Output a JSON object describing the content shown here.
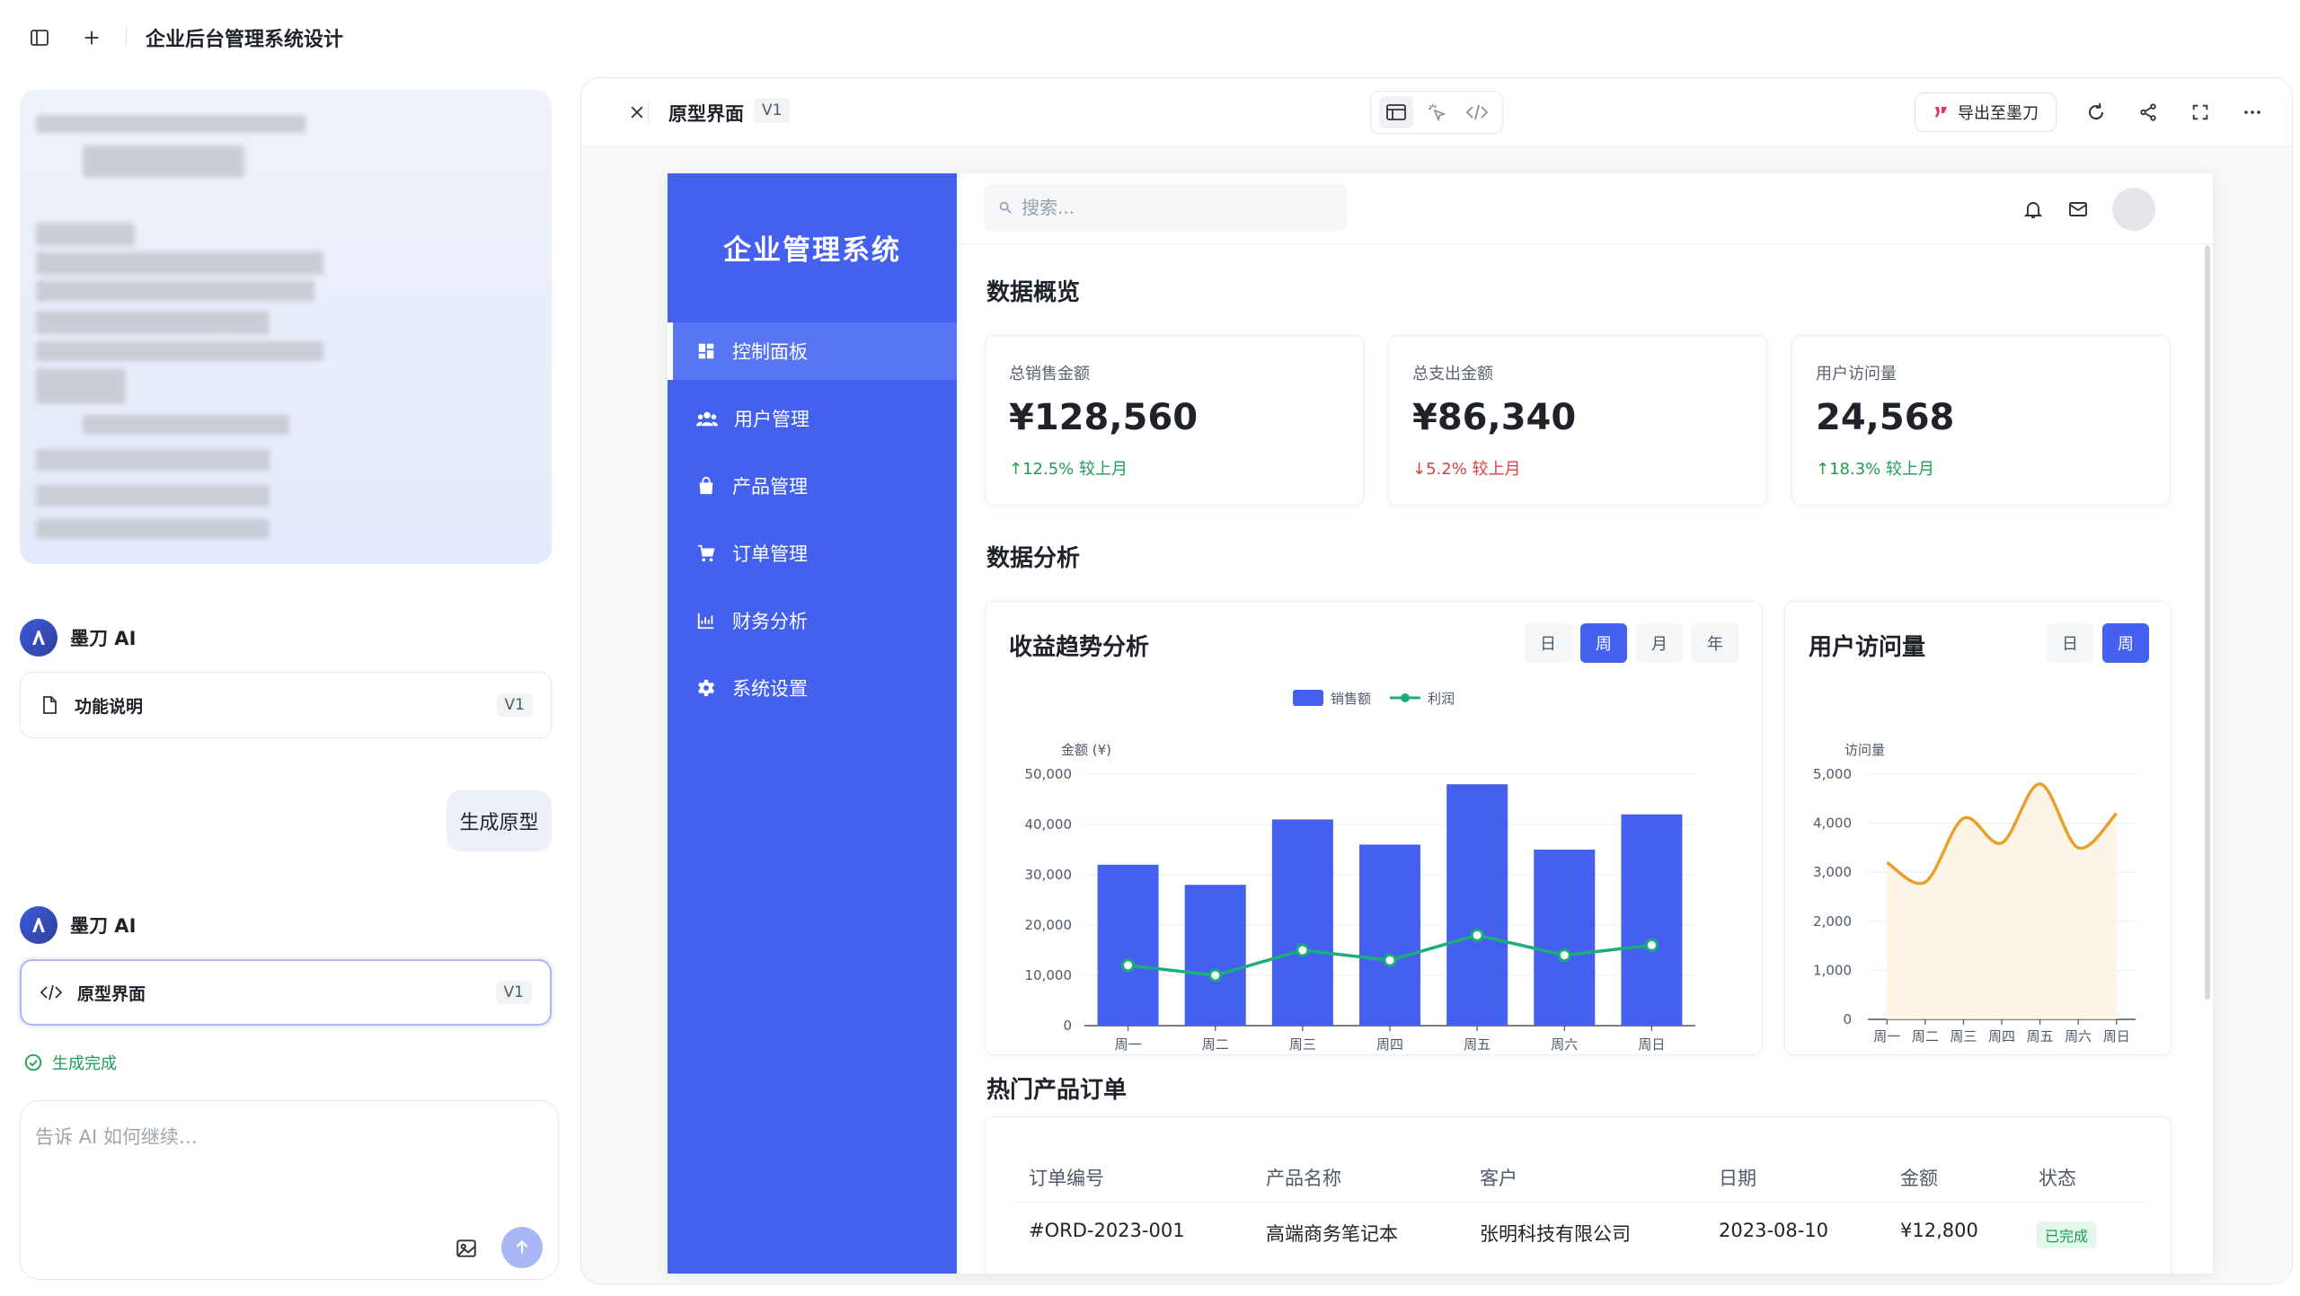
{
  "topbar": {
    "title": "企业后台管理系统设计"
  },
  "chat": {
    "messages": [
      {
        "sender": "墨刀 AI",
        "file": "功能说明",
        "version": "V1"
      },
      {
        "user_text": "生成原型"
      },
      {
        "sender": "墨刀 AI",
        "file": "原型界面",
        "version": "V1"
      }
    ],
    "status": "生成完成",
    "input_placeholder": "告诉 AI 如何继续…"
  },
  "preview_panel": {
    "title": "原型界面",
    "version": "V1",
    "export_label": "导出至墨刀"
  },
  "app": {
    "brand": "企业管理系统",
    "nav": [
      {
        "label": "控制面板",
        "icon": "dashboard-icon",
        "active": true
      },
      {
        "label": "用户管理",
        "icon": "users-icon",
        "active": false
      },
      {
        "label": "产品管理",
        "icon": "bag-icon",
        "active": false
      },
      {
        "label": "订单管理",
        "icon": "cart-icon",
        "active": false
      },
      {
        "label": "财务分析",
        "icon": "finance-icon",
        "active": false
      },
      {
        "label": "系统设置",
        "icon": "gear-icon",
        "active": false
      }
    ],
    "search_placeholder": "搜索...",
    "overview_title": "数据概览",
    "kpis": [
      {
        "label": "总销售金额",
        "value": "¥128,560",
        "change": "↑12.5% 较上月",
        "trend": "up"
      },
      {
        "label": "总支出金额",
        "value": "¥86,340",
        "change": "↓5.2% 较上月",
        "trend": "down"
      },
      {
        "label": "用户访问量",
        "value": "24,568",
        "change": "↑18.3% 较上月",
        "trend": "up"
      }
    ],
    "analysis_title": "数据分析",
    "revenue_card": {
      "title": "收益趋势分析",
      "ranges": [
        "日",
        "周",
        "月",
        "年"
      ],
      "selected": "周"
    },
    "visits_card": {
      "title": "用户访问量",
      "ranges": [
        "日",
        "周"
      ],
      "selected": "周"
    },
    "orders_title": "热门产品订单",
    "orders": {
      "headers": [
        "订单编号",
        "产品名称",
        "客户",
        "日期",
        "金额",
        "状态"
      ],
      "rows": [
        {
          "id": "#ORD-2023-001",
          "product": "高端商务笔记本",
          "customer": "张明科技有限公司",
          "date": "2023-08-10",
          "amount": "¥12,800",
          "status": "已完成"
        }
      ]
    }
  },
  "colors": {
    "primary": "#4361ee",
    "profit": "#1aae7a",
    "visits": "#e7a12a",
    "up": "#1f9d55",
    "down": "#e03e3e"
  },
  "chart_data": [
    {
      "type": "bar",
      "legend": [
        "销售额",
        "利润"
      ],
      "ylabel": "金额 (¥)",
      "categories": [
        "周一",
        "周二",
        "周三",
        "周四",
        "周五",
        "周六",
        "周日"
      ],
      "ylim": [
        0,
        50000
      ],
      "yticks": [
        "0",
        "10,000",
        "20,000",
        "30,000",
        "40,000",
        "50,000"
      ],
      "series": [
        {
          "name": "销售额",
          "type": "bar",
          "values": [
            32000,
            28000,
            41000,
            36000,
            48000,
            35000,
            42000
          ]
        },
        {
          "name": "利润",
          "type": "line",
          "values": [
            12000,
            10000,
            15000,
            13000,
            18000,
            14000,
            16000
          ]
        }
      ]
    },
    {
      "type": "area",
      "ylabel": "访问量",
      "categories": [
        "周一",
        "周二",
        "周三",
        "周四",
        "周五",
        "周六",
        "周日"
      ],
      "ylim": [
        0,
        5000
      ],
      "yticks": [
        "0",
        "1,000",
        "2,000",
        "3,000",
        "4,000",
        "5,000"
      ],
      "series": [
        {
          "values": [
            3200,
            2800,
            4100,
            3600,
            4800,
            3500,
            4200
          ]
        }
      ]
    }
  ]
}
